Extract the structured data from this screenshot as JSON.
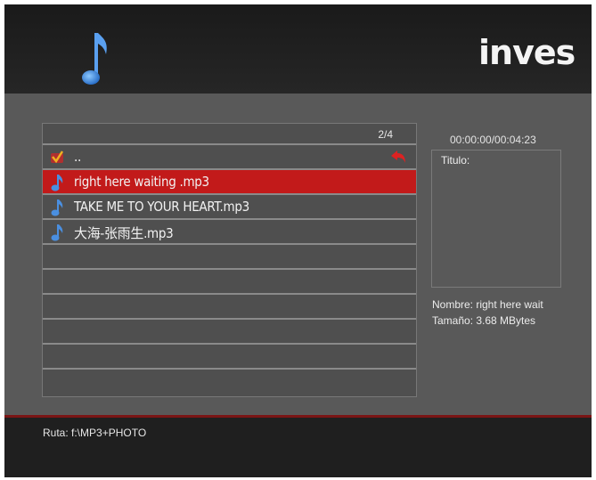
{
  "brand": {
    "logo_text": "inves"
  },
  "header": {
    "media_icon": "music-note-icon"
  },
  "file_list": {
    "page_indicator": "2/4",
    "rows": [
      {
        "label": "..",
        "icon": "folder-up-icon",
        "selected": false,
        "back_icon": "back-arrow-icon"
      },
      {
        "label": "right here waiting .mp3",
        "icon": "music-note-icon",
        "selected": true
      },
      {
        "label": "TAKE ME TO YOUR HEART.mp3",
        "icon": "music-note-icon",
        "selected": false
      },
      {
        "label": "大海-张雨生.mp3",
        "icon": "music-note-icon",
        "selected": false
      }
    ]
  },
  "info": {
    "time": "00:00:00/00:04:23",
    "title_label": "Titulo:",
    "name_line": "Nombre: right here wait",
    "size_line": "Tamaño: 3.68 MBytes"
  },
  "footer": {
    "path": "Ruta: f:\\MP3+PHOTO"
  },
  "colors": {
    "header_bg": "#1f1f1f",
    "content_bg": "#595959",
    "selected_row": "#c21a1a",
    "note_blue": "#4a8fe0"
  }
}
